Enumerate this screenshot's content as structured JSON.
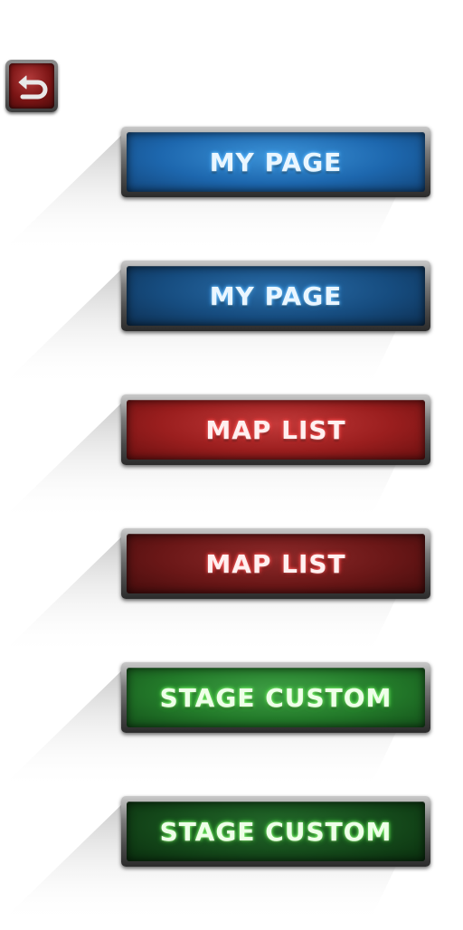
{
  "back_button": {
    "icon": "back-arrow-icon",
    "color": "#7a1414"
  },
  "buttons": [
    {
      "label": "MY PAGE",
      "variant": "blue",
      "state": "normal",
      "color": "#1d67ae"
    },
    {
      "label": "MY PAGE",
      "variant": "blue",
      "state": "pressed",
      "color": "#164c7f"
    },
    {
      "label": "MAP LIST",
      "variant": "red",
      "state": "normal",
      "color": "#9a1e1e"
    },
    {
      "label": "MAP LIST",
      "variant": "red",
      "state": "pressed",
      "color": "#6a1717"
    },
    {
      "label": "STAGE CUSTOM",
      "variant": "green",
      "state": "normal",
      "color": "#237a2a"
    },
    {
      "label": "STAGE CUSTOM",
      "variant": "green",
      "state": "pressed",
      "color": "#154a1b"
    }
  ]
}
